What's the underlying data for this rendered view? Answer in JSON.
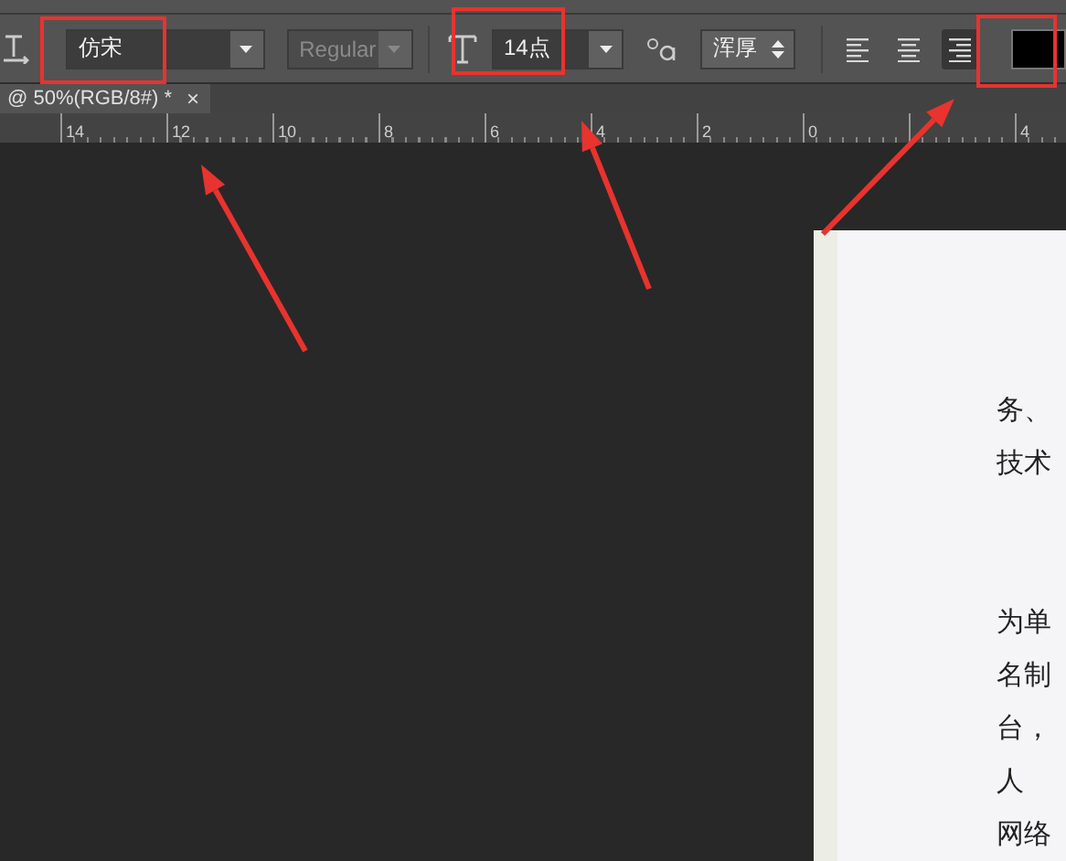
{
  "options_bar": {
    "font_family": {
      "value": "仿宋"
    },
    "font_style": {
      "value": "Regular",
      "disabled": true
    },
    "font_size": {
      "value": "14点"
    },
    "anti_alias": {
      "value": "浑厚"
    },
    "alignment": [
      {
        "kind": "left",
        "selected": false
      },
      {
        "kind": "center",
        "selected": false
      },
      {
        "kind": "right",
        "selected": true
      }
    ],
    "text_color": {
      "color": "#000000"
    }
  },
  "document_tab": {
    "title": "@ 50%(RGB/8#) *",
    "close": "×"
  },
  "ruler": {
    "ticks": [
      {
        "kind": "label",
        "text": "14"
      },
      {
        "kind": "label",
        "text": "12"
      },
      {
        "kind": "label",
        "text": "10"
      },
      {
        "kind": "label",
        "text": "8"
      },
      {
        "kind": "label",
        "text": "6"
      },
      {
        "kind": "label",
        "text": "4"
      },
      {
        "kind": "label",
        "text": "2"
      },
      {
        "kind": "label",
        "text": "0"
      },
      {
        "kind": "mark"
      },
      {
        "kind": "label",
        "text": "4"
      }
    ]
  },
  "document": {
    "paragraphs": [
      [
        "务、",
        "技术"
      ],
      [
        "为单",
        "名制",
        "台，",
        "人",
        "网络"
      ]
    ]
  }
}
